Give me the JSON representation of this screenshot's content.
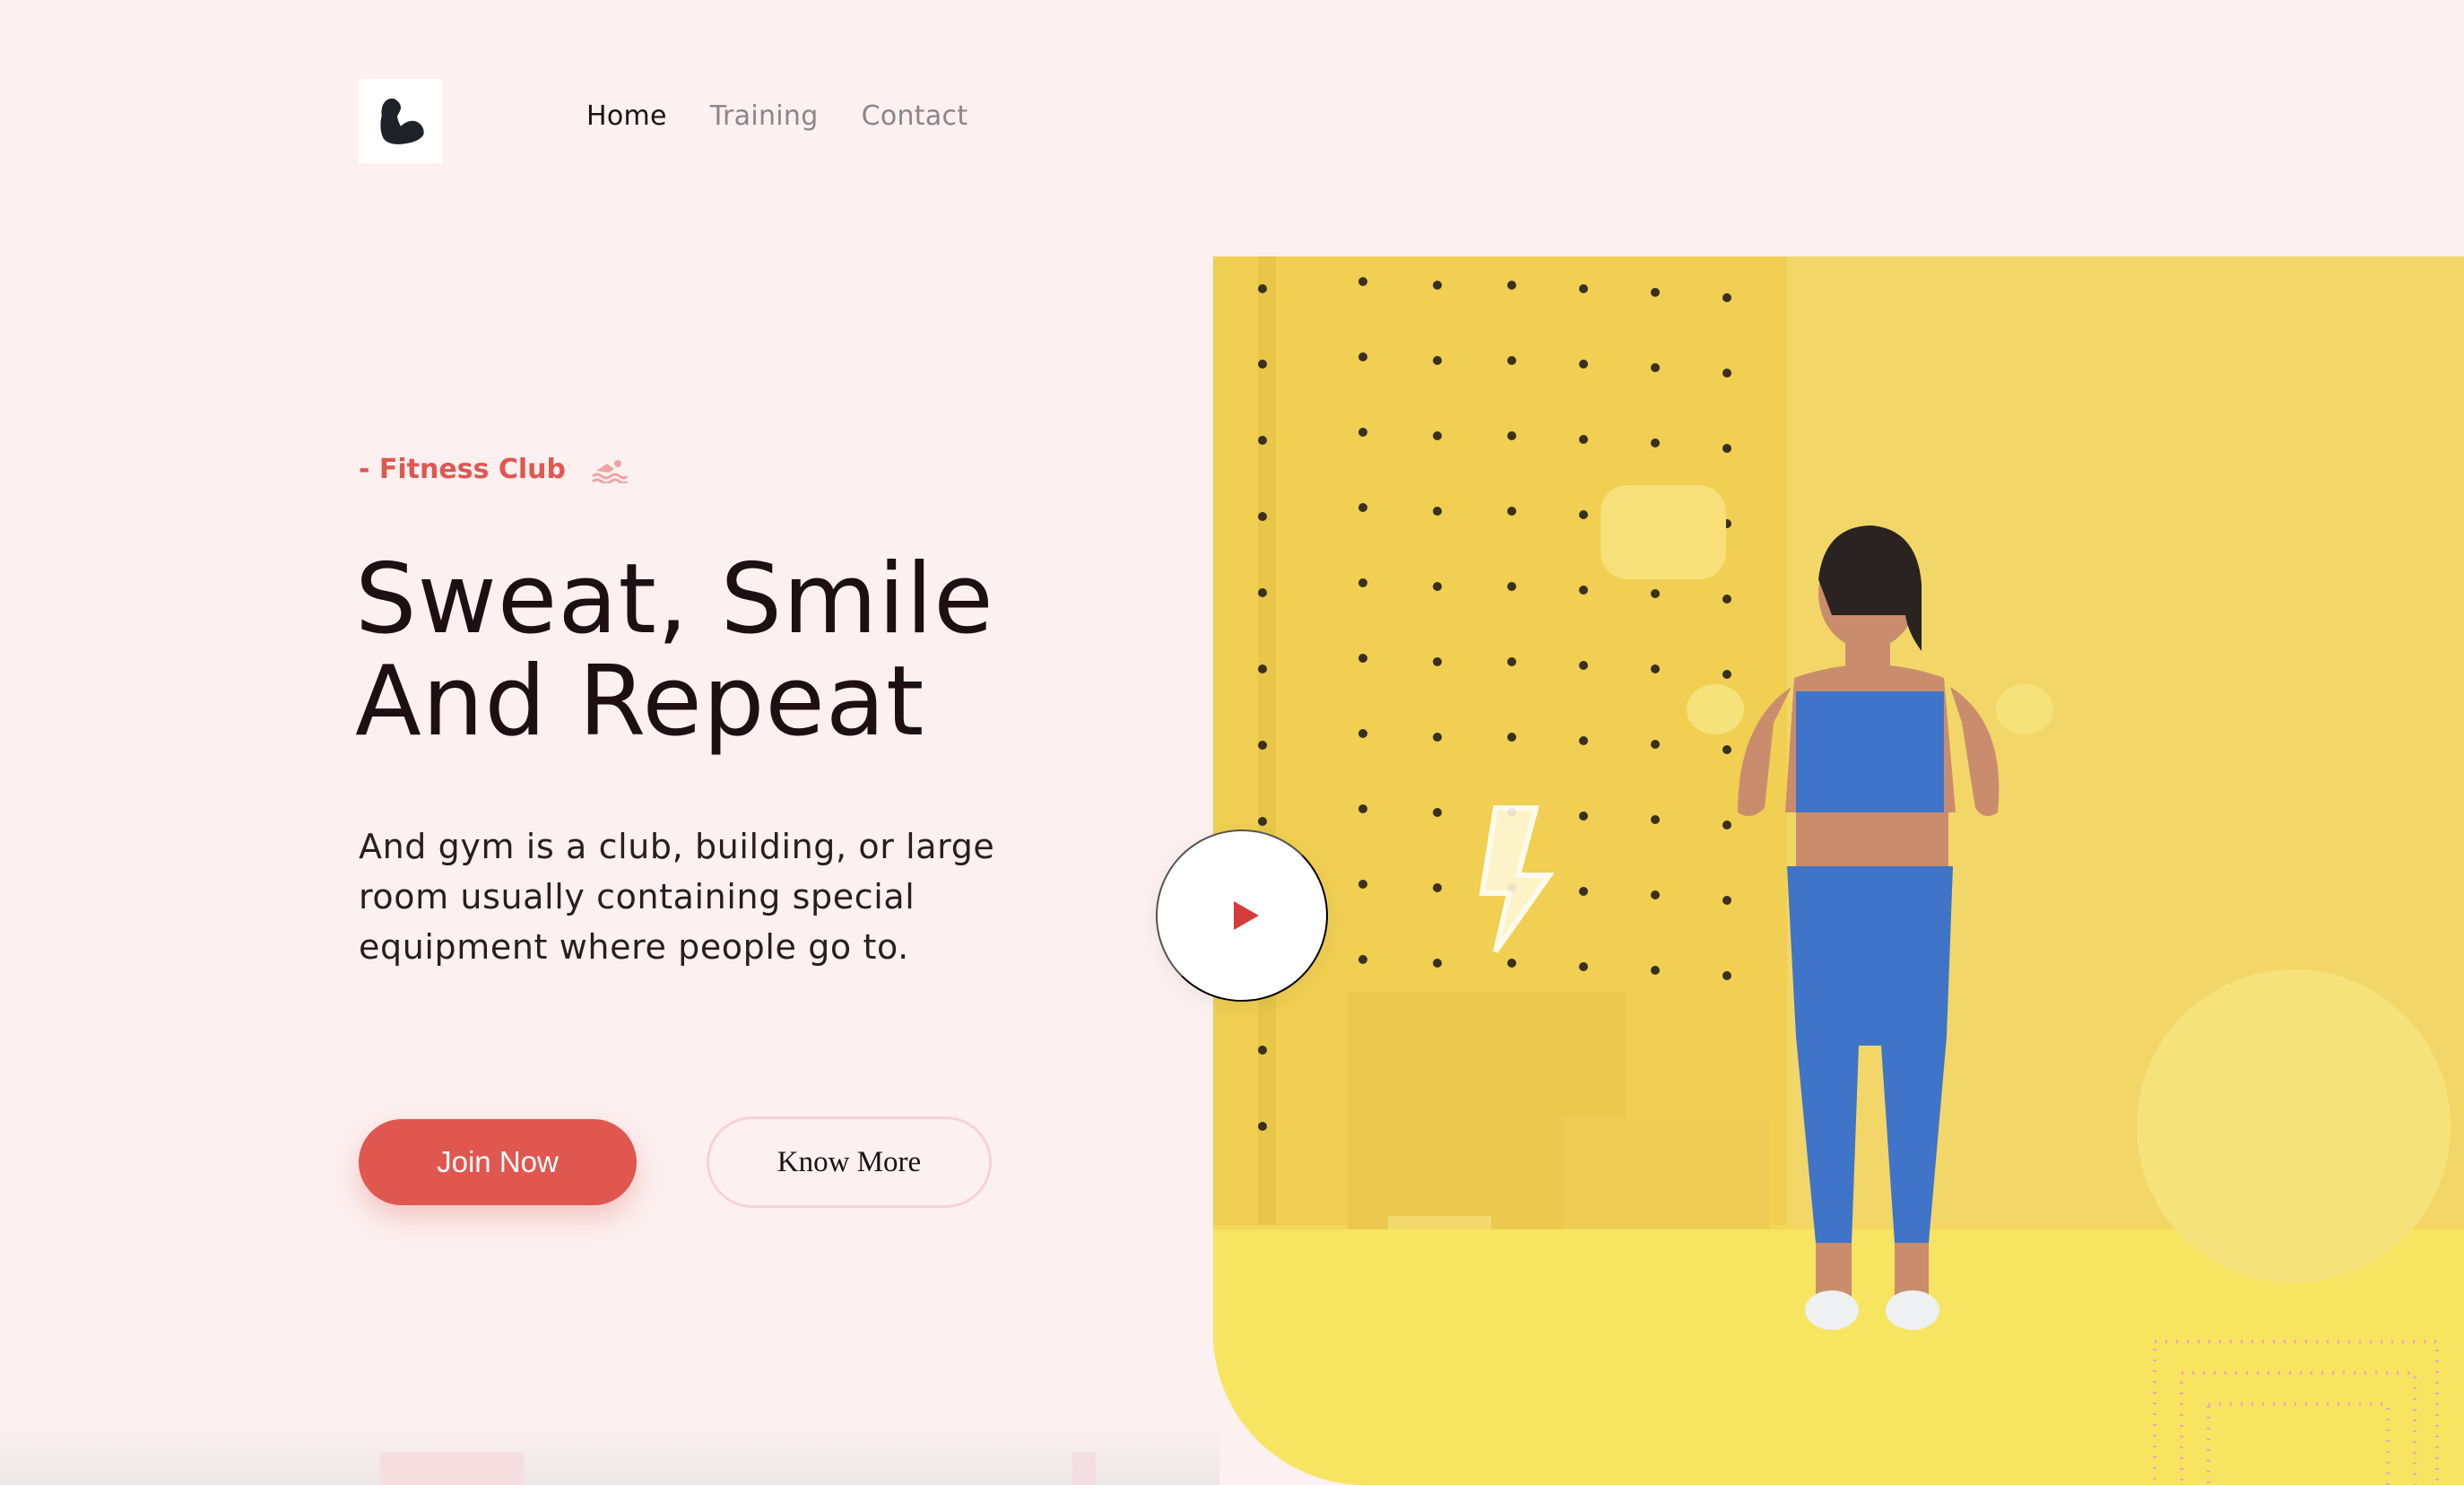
{
  "header": {
    "logo_icon": "flexed-bicep-icon",
    "nav": [
      {
        "label": "Home",
        "active": true
      },
      {
        "label": "Training",
        "active": false
      },
      {
        "label": "Contact",
        "active": false
      }
    ]
  },
  "hero": {
    "eyebrow": "- Fitness Club",
    "eyebrow_icon": "swimmer-icon",
    "headline_line1": "Sweat, Smile",
    "headline_line2": "And Repeat",
    "description": "And gym is a club, building, or large room usually containing special equipment where people go to.",
    "join_button": "Join Now",
    "know_button": "Know More",
    "play_icon": "play-icon",
    "image_alt": "woman-with-dumbbells-photo"
  },
  "colors": {
    "accent": "#e0574f",
    "background": "#fcf0f0",
    "heading": "#1e0f12",
    "hero_yellow": "#f6d65a",
    "outfit_blue": "#3f74c8"
  }
}
